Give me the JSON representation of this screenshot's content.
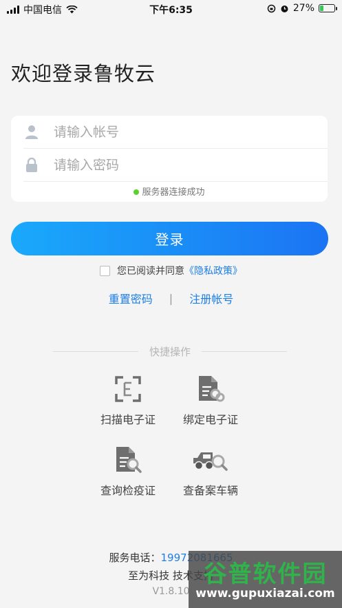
{
  "status": {
    "carrier": "中国电信",
    "time": "下午6:35",
    "battery": "27%",
    "battery_level": 0.27
  },
  "header": {
    "title": "欢迎登录鲁牧云"
  },
  "form": {
    "account_placeholder": "请输入帐号",
    "password_placeholder": "请输入密码",
    "server_status": "服务器连接成功"
  },
  "login_label": "登录",
  "agree": {
    "text": "您已阅读并同意",
    "link": "《隐私政策》"
  },
  "links": {
    "reset": "重置密码",
    "separator": "|",
    "register": "注册帐号"
  },
  "quick": {
    "title": "快捷操作",
    "items": [
      {
        "label": "扫描电子证",
        "icon": "scan-certificate-icon"
      },
      {
        "label": "绑定电子证",
        "icon": "bind-certificate-icon"
      },
      {
        "label": "查询检疫证",
        "icon": "query-quarantine-icon"
      },
      {
        "label": "查备案车辆",
        "icon": "vehicle-search-icon"
      }
    ]
  },
  "footer": {
    "phone_label": "服务电话：",
    "phone": "19972081665",
    "company": "至为科技 技术支持",
    "version": "V1.8.10"
  },
  "watermark": {
    "brand": "谷普软件园",
    "url": "www.gupuxiazai.com"
  },
  "colors": {
    "accent": "#1d7fe6",
    "button_start": "#1aa9fb",
    "button_end": "#1b74f3",
    "success": "#5ad12c"
  }
}
